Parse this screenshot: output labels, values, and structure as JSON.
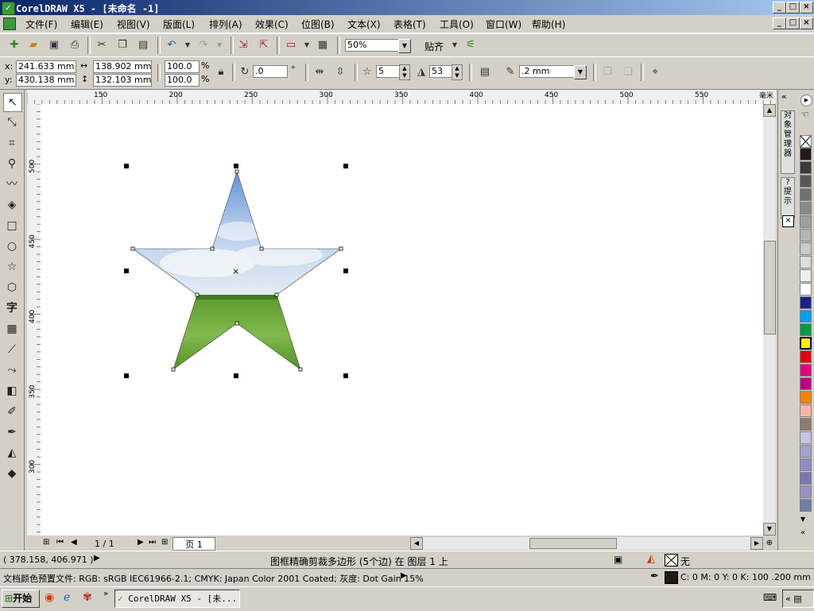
{
  "window": {
    "title": "CorelDRAW X5 - [未命名 -1]",
    "icon": "coreldraw-app-icon",
    "buttons": [
      "_",
      "□",
      "×"
    ]
  },
  "menu": [
    {
      "label": "文件(F)"
    },
    {
      "label": "编辑(E)"
    },
    {
      "label": "视图(V)"
    },
    {
      "label": "版面(L)"
    },
    {
      "label": "排列(A)"
    },
    {
      "label": "效果(C)"
    },
    {
      "label": "位图(B)"
    },
    {
      "label": "文本(X)"
    },
    {
      "label": "表格(T)"
    },
    {
      "label": "工具(O)"
    },
    {
      "label": "窗口(W)"
    },
    {
      "label": "帮助(H)"
    }
  ],
  "standard_toolbar": {
    "zoom_value": "50%",
    "snap_label": "贴齐"
  },
  "property_bar": {
    "x_label": "x:",
    "x_value": "241.633 mm",
    "y_label": "y:",
    "y_value": "430.138 mm",
    "width_value": "138.902 mm",
    "height_value": "132.103 mm",
    "scale_w": "100.0",
    "scale_h": "100.0",
    "percent": "%",
    "rotation_value": ".0",
    "degree": "°",
    "points_value": "5",
    "sharpness_value": "53",
    "outline_width": ".2 mm"
  },
  "ruler": {
    "h_ticks": [
      "150",
      "200",
      "250",
      "300",
      "350",
      "400",
      "450",
      "500",
      "550"
    ],
    "h_unit": "毫米",
    "v_ticks": [
      "500",
      "450",
      "400",
      "350",
      "300"
    ]
  },
  "page_nav": {
    "counter": "1 / 1",
    "page_tab": "页 1"
  },
  "docker": {
    "tab1": "对象管理器",
    "tab2": "提示"
  },
  "palette": {
    "colors": [
      "#231815",
      "#3e3a39",
      "#595757",
      "#727171",
      "#898989",
      "#9fa0a0",
      "#b5b5b6",
      "#c9caca",
      "#dcdddd",
      "#efefef",
      "#ffffff",
      "#1d2088",
      "#00a0e9",
      "#009944",
      "#fff100",
      "#e60012",
      "#e4007f",
      "#be0081",
      "#f08300",
      "#f6b7a9",
      "#8f7a6b",
      "#c9c3e6",
      "#a3a3d0",
      "#8c8fc7",
      "#7c74b5",
      "#9d90c2",
      "#6d7fa3"
    ]
  },
  "status": {
    "coords": "( 378.158, 406.971 )",
    "object_info": "图框精确剪裁多边形 (5个边) 在 图层 1 上",
    "fill_label": "无",
    "color_profile": "文档颜色预置文件: RGB: sRGB IEC61966-2.1; CMYK: Japan Color 2001 Coated; 灰度: Dot Gain 15%",
    "outline_info": "C: 0 M: 0 Y: 0 K: 100  .200 mm"
  },
  "taskbar": {
    "start_label": "开始",
    "task_label": "CorelDRAW X5 - [未..."
  }
}
